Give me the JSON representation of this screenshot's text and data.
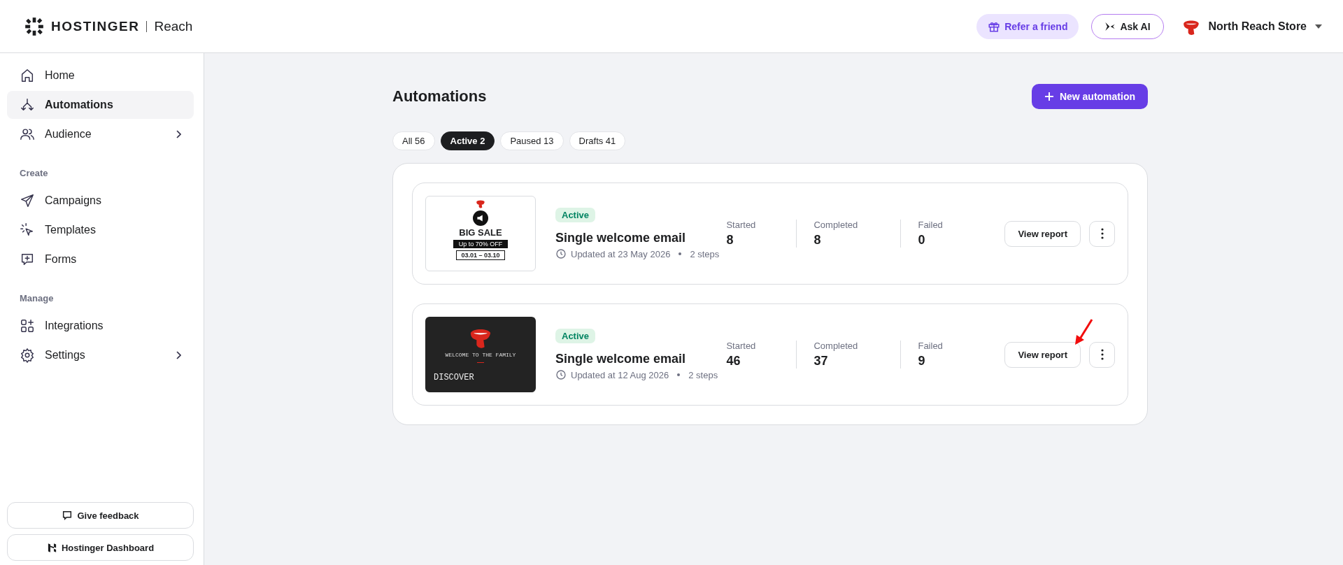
{
  "header": {
    "brand": "HOSTINGER",
    "product": "Reach",
    "refer": "Refer a friend",
    "ask_ai": "Ask AI",
    "store": "North Reach Store"
  },
  "sidebar": {
    "sections": [
      {
        "items": [
          {
            "label": "Home",
            "selected": false,
            "chevron": false
          },
          {
            "label": "Automations",
            "selected": true,
            "chevron": false
          },
          {
            "label": "Audience",
            "selected": false,
            "chevron": true
          }
        ]
      },
      {
        "title": "Create",
        "items": [
          {
            "label": "Campaigns",
            "selected": false,
            "chevron": false
          },
          {
            "label": "Templates",
            "selected": false,
            "chevron": false
          },
          {
            "label": "Forms",
            "selected": false,
            "chevron": false
          }
        ]
      },
      {
        "title": "Manage",
        "items": [
          {
            "label": "Integrations",
            "selected": false,
            "chevron": false
          },
          {
            "label": "Settings",
            "selected": false,
            "chevron": true
          }
        ]
      }
    ],
    "footer": [
      "Give feedback",
      "Hostinger Dashboard"
    ]
  },
  "page": {
    "title": "Automations",
    "new_button": "New automation",
    "filters": [
      {
        "label": "All 56",
        "selected": false
      },
      {
        "label": "Active 2",
        "selected": true
      },
      {
        "label": "Paused 13",
        "selected": false
      },
      {
        "label": "Drafts 41",
        "selected": false
      }
    ],
    "automations": [
      {
        "thumbnail": {
          "kind": "sale",
          "texts": [
            "BIG SALE",
            "Up to 70% OFF",
            "03.01 – 03.10"
          ]
        },
        "status": "Active",
        "name": "Single welcome email",
        "updated": "Updated at 23 May 2026",
        "steps": "2 steps",
        "stats": [
          {
            "label": "Started",
            "value": "8"
          },
          {
            "label": "Completed",
            "value": "8"
          },
          {
            "label": "Failed",
            "value": "0"
          }
        ],
        "action": "View report",
        "pointer": false
      },
      {
        "thumbnail": {
          "kind": "dark",
          "texts": [
            "WELCOME TO THE FAMILY",
            "DISCOVER"
          ]
        },
        "status": "Active",
        "name": "Single welcome email",
        "updated": "Updated at 12 Aug 2026",
        "steps": "2 steps",
        "stats": [
          {
            "label": "Started",
            "value": "46"
          },
          {
            "label": "Completed",
            "value": "37"
          },
          {
            "label": "Failed",
            "value": "9"
          }
        ],
        "action": "View report",
        "pointer": true
      }
    ]
  }
}
